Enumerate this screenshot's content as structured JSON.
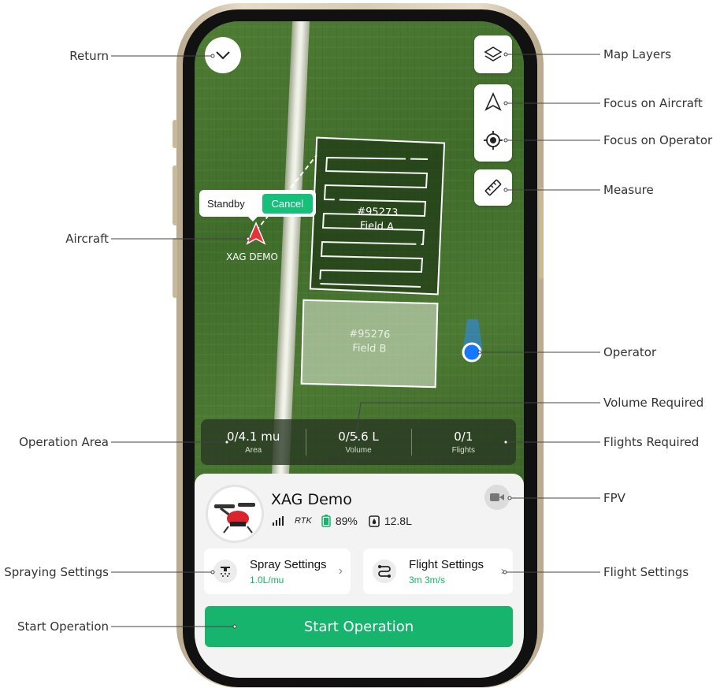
{
  "callouts": {
    "return": "Return",
    "aircraft": "Aircraft",
    "operation_area": "Operation Area",
    "spraying_settings": "Spraying Settings",
    "start_operation": "Start Operation",
    "map_layers": "Map Layers",
    "focus_aircraft": "Focus on Aircraft",
    "focus_operator": "Focus on Operator",
    "measure": "Measure",
    "operator": "Operator",
    "volume_required": "Volume Required",
    "flights_required": "Flights Required",
    "fpv": "FPV",
    "flight_settings": "Flight Settings"
  },
  "map": {
    "standby_label": "Standby",
    "cancel_label": "Cancel",
    "aircraft_name": "XAG DEMO",
    "field_a": {
      "id": "#95273",
      "name": "Field A"
    },
    "field_b": {
      "id": "#95276",
      "name": "Field B"
    }
  },
  "stats": {
    "area": {
      "value": "0/4.1 mu",
      "label": "Area"
    },
    "volume": {
      "value": "0/5.6 L",
      "label": "Volume"
    },
    "flights": {
      "value": "0/1",
      "label": "Flights"
    }
  },
  "device": {
    "name": "XAG Demo",
    "rtk_label": "RTK",
    "battery": "89%",
    "tank": "12.8L"
  },
  "spray_settings": {
    "title": "Spray Settings",
    "value": "1.0L/mu"
  },
  "flight_settings": {
    "title": "Flight Settings",
    "value": "3m 3m/s"
  },
  "start_button": "Start Operation",
  "colors": {
    "accent": "#17b46e",
    "aircraft": "#e8313a",
    "operator": "#1677ff"
  }
}
